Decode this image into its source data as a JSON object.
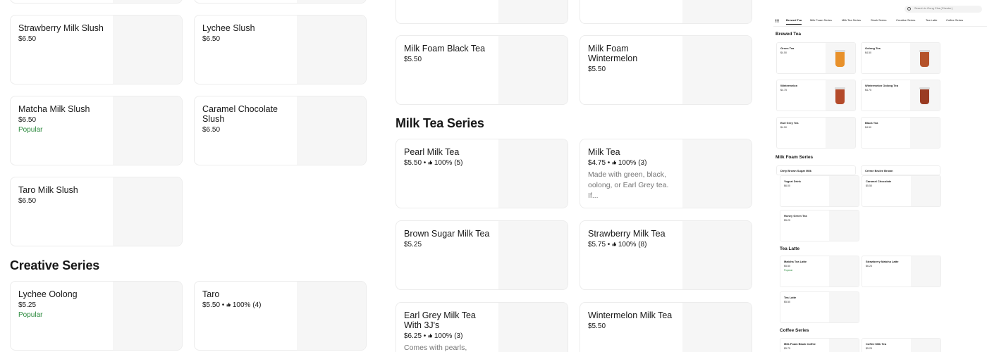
{
  "left_column": {
    "top_partial_cards": [
      {},
      {}
    ],
    "cards": [
      {
        "name": "Strawberry Milk Slush",
        "price": "$6.50"
      },
      {
        "name": "Lychee Slush",
        "price": "$6.50"
      },
      {
        "name": "Matcha Milk Slush",
        "price": "$6.50",
        "popular": "Popular"
      },
      {
        "name": "Caramel Chocolate Slush",
        "price": "$6.50"
      },
      {
        "name": "Taro Milk Slush",
        "price": "$6.50"
      }
    ],
    "creative_title": "Creative Series",
    "creative_cards": [
      {
        "name": "Lychee Oolong",
        "price": "$5.25",
        "popular": "Popular"
      },
      {
        "name": "Taro",
        "price": "$5.50 •",
        "rating": "100% (4)"
      }
    ]
  },
  "middle_column": {
    "foam_cards": [
      {
        "name": "Milk Foam Black Tea",
        "price": "$5.50"
      },
      {
        "name": "Milk Foam Wintermelon",
        "price": "$5.50"
      }
    ],
    "milk_tea_title": "Milk Tea Series",
    "milk_tea_cards": [
      {
        "name": "Pearl Milk Tea",
        "price": "$5.50 •",
        "rating": "100% (5)"
      },
      {
        "name": "Milk Tea",
        "price": "$4.75 •",
        "rating": "100% (3)",
        "desc": "Made with green, black, oolong, or Earl Grey tea. If..."
      },
      {
        "name": "Brown Sugar Milk Tea",
        "price": "$5.25"
      },
      {
        "name": "Strawberry Milk Tea",
        "price": "$5.75 •",
        "rating": "100% (8)"
      },
      {
        "name": "Earl Grey Milk Tea With 3J's",
        "price": "$6.25 •",
        "rating": "100% (3)",
        "desc": "Comes with pearls, pudding,"
      },
      {
        "name": "Wintermelon Milk Tea",
        "price": "$5.50"
      }
    ]
  },
  "mini": {
    "search_placeholder": "Search in Gong Cha (Chester)",
    "tabs": [
      "Brewed Tea",
      "Milk Foam Series",
      "Milk Tea Series",
      "Slush Series",
      "Creative Series",
      "Tea Latte",
      "Coffee Series"
    ],
    "sections": {
      "brewed": "Brewed Tea",
      "milk_foam": "Milk Foam Series",
      "tea_latte": "Tea Latte",
      "coffee": "Coffee Series"
    },
    "brewed_items": [
      {
        "name": "Green Tea",
        "price": "$4.50",
        "cup": "#e8912b"
      },
      {
        "name": "Oolong Tea",
        "price": "$4.50",
        "cup": "#b5532a"
      },
      {
        "name": "Wintermelon",
        "price": "$4.75",
        "cup": "#b44a2a"
      },
      {
        "name": "Wintermelon Oolong Tea",
        "price": "$4.75",
        "cup": "#9a3b22"
      },
      {
        "name": "Earl Grey Tea",
        "price": "$4.50"
      },
      {
        "name": "Black Tea",
        "price": "$4.50"
      }
    ],
    "foam_peek": [
      "Dirty Brown Sugar Milk",
      "Crème Brulee Brown"
    ],
    "foam_items": [
      {
        "name": "Yogurt Drink",
        "price": "$6.00"
      },
      {
        "name": "Caramel Chocolate",
        "price": "$5.50"
      },
      {
        "name": "Honey Green Tea",
        "price": "$5.25"
      }
    ],
    "latte_items": [
      {
        "name": "Matcha Tea Latte",
        "price": "$5.50",
        "popular": "Popular"
      },
      {
        "name": "Strawberry Matcha Latte",
        "price": "$6.25"
      },
      {
        "name": "Tea Latte",
        "price": "$5.50"
      }
    ],
    "coffee_items": [
      {
        "name": "Milk Foam Black Coffee",
        "price": "$5.75"
      },
      {
        "name": "Coffee Milk Tea",
        "price": "$5.25"
      }
    ]
  }
}
